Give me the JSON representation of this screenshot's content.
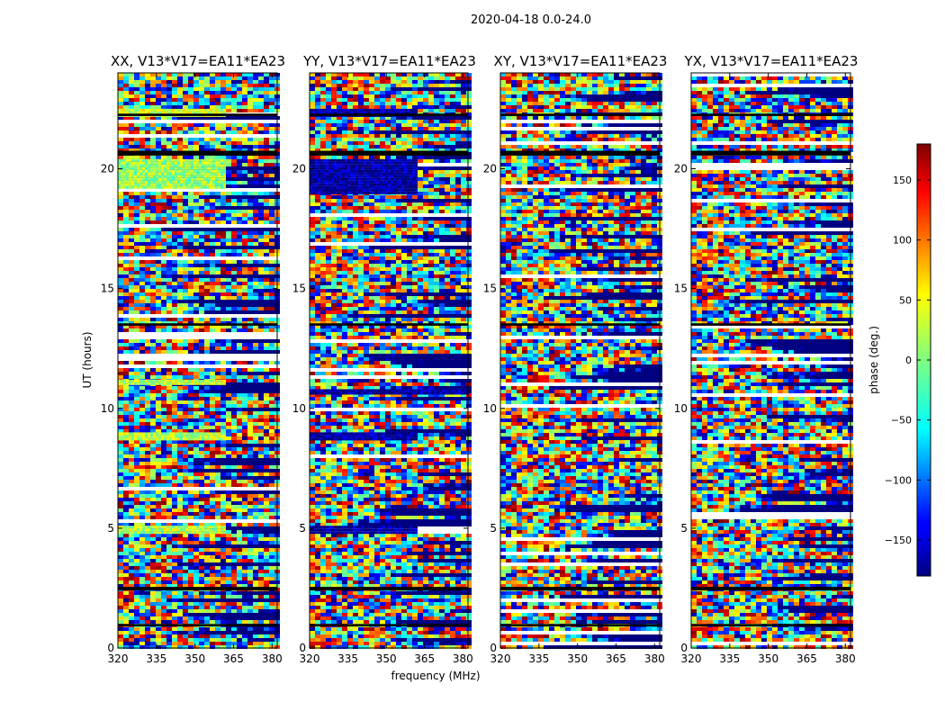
{
  "figure": {
    "suptitle": "2020-04-18 0.0-24.0",
    "xlabel": "frequency (MHz)",
    "ylabel": "UT (hours)",
    "colorbar_label": "phase (deg.)"
  },
  "chart_data": {
    "type": "heatmap",
    "title": "2020-04-18 0.0-24.0",
    "xlabel": "frequency (MHz)",
    "ylabel": "UT (hours)",
    "xlim": [
      320,
      382
    ],
    "ylim": [
      0,
      24
    ],
    "xticks": [
      "320",
      "335",
      "350",
      "365",
      "380"
    ],
    "yticks": [
      "0",
      "5",
      "10",
      "15",
      "20"
    ],
    "panels": [
      {
        "title": "XX, V13*V17=EA11*EA23"
      },
      {
        "title": "YY, V13*V17=EA11*EA23"
      },
      {
        "title": "XY, V13*V17=EA11*EA23"
      },
      {
        "title": "YX, V13*V17=EA11*EA23"
      }
    ],
    "colorbar": {
      "label": "phase (deg.)",
      "range": [
        -180,
        180
      ],
      "ticks": [
        "150",
        "100",
        "50",
        "0",
        "−50",
        "−100",
        "−150"
      ],
      "colormap": "jet"
    },
    "flagged_ut_bands": [
      [
        0.9,
        1.0
      ],
      [
        2.4,
        2.55
      ],
      [
        13.45,
        13.55
      ],
      [
        20.55,
        20.75
      ],
      [
        22.2,
        22.3
      ]
    ],
    "coherent_segments": [
      {
        "panel": 0,
        "ut": [
          19.2,
          20.4
        ],
        "freq": [
          320,
          362
        ],
        "phase_deg": 10
      },
      {
        "panel": 0,
        "ut": [
          8.7,
          9.0
        ],
        "freq": [
          320,
          362
        ],
        "phase_deg": 20
      },
      {
        "panel": 0,
        "ut": [
          4.8,
          5.1
        ],
        "freq": [
          320,
          362
        ],
        "phase_deg": 20
      },
      {
        "panel": 0,
        "ut": [
          11.0,
          11.2
        ],
        "freq": [
          320,
          362
        ],
        "phase_deg": 25
      },
      {
        "panel": 0,
        "ut": [
          22.2,
          22.5
        ],
        "freq": [
          320,
          362
        ],
        "phase_deg": 30
      },
      {
        "panel": 1,
        "ut": [
          19.0,
          20.4
        ],
        "freq": [
          320,
          362
        ],
        "phase_deg": -170
      },
      {
        "panel": 1,
        "ut": [
          8.7,
          9.0
        ],
        "freq": [
          320,
          362
        ],
        "phase_deg": -170
      },
      {
        "panel": 1,
        "ut": [
          4.8,
          5.1
        ],
        "freq": [
          320,
          362
        ],
        "phase_deg": -170
      },
      {
        "panel": 1,
        "ut": [
          10.6,
          10.8
        ],
        "freq": [
          320,
          382
        ],
        "phase_deg": -170
      },
      {
        "panel": 1,
        "ut": [
          22.2,
          22.5
        ],
        "freq": [
          320,
          362
        ],
        "phase_deg": -170
      }
    ],
    "grid": false
  },
  "colors": {
    "flag": "#ffffff",
    "flag_edge": "#000000",
    "colormap": [
      "#000080",
      "#0000ff",
      "#00ffff",
      "#7fff7f",
      "#ffff00",
      "#ff0000",
      "#800000"
    ]
  }
}
